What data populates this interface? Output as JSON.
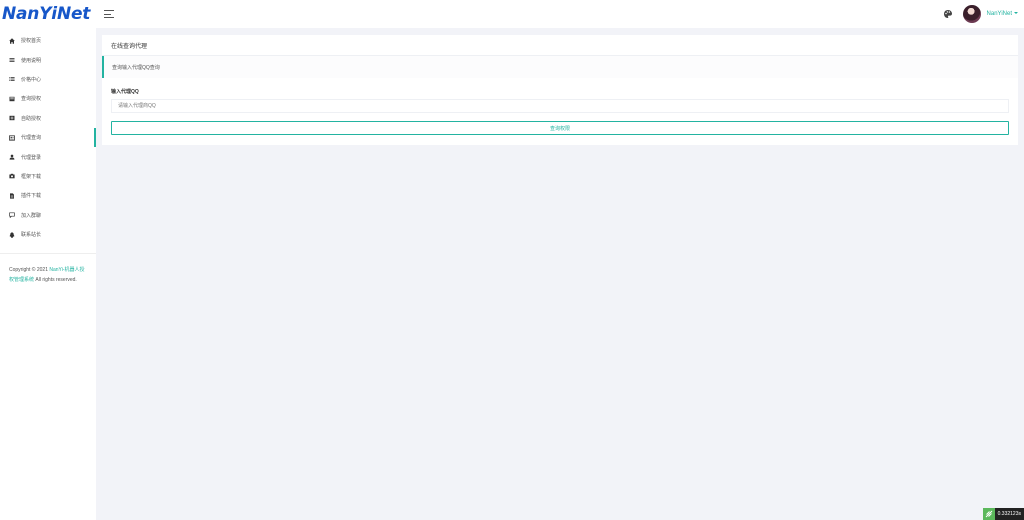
{
  "header": {
    "logo": "NanYiNet",
    "user_name": "NanYiNet"
  },
  "sidebar": {
    "items": [
      {
        "label": "授权首页",
        "icon": "home-icon"
      },
      {
        "label": "使用说明",
        "icon": "list-icon"
      },
      {
        "label": "价格中心",
        "icon": "list-bullet-icon"
      },
      {
        "label": "查询授权",
        "icon": "book-icon"
      },
      {
        "label": "自助授权",
        "icon": "book-plus-icon"
      },
      {
        "label": "代理查询",
        "icon": "id-card-icon",
        "active": true
      },
      {
        "label": "代理登录",
        "icon": "user-icon"
      },
      {
        "label": "框架下载",
        "icon": "camera-icon"
      },
      {
        "label": "插件下载",
        "icon": "file-icon"
      },
      {
        "label": "加入群聊",
        "icon": "chat-icon"
      },
      {
        "label": "联系站长",
        "icon": "qq-icon"
      }
    ],
    "copyright_prefix": "Copyright © 2021 ",
    "copyright_link": "NanYi-机器人授权管理系统",
    "copyright_suffix": " All rights reserved."
  },
  "main": {
    "card_title": "在线查询代理",
    "info_text": "查询输入代理QQ查询",
    "form_label": "输入代理QQ",
    "input_placeholder": "请输入代理商QQ",
    "input_value": "",
    "button_label": "查询权限"
  },
  "perf_badge": {
    "text": "0.332123s"
  },
  "colors": {
    "accent": "#23b3a1",
    "logo": "#1757c9",
    "background": "#f2f3f8"
  }
}
